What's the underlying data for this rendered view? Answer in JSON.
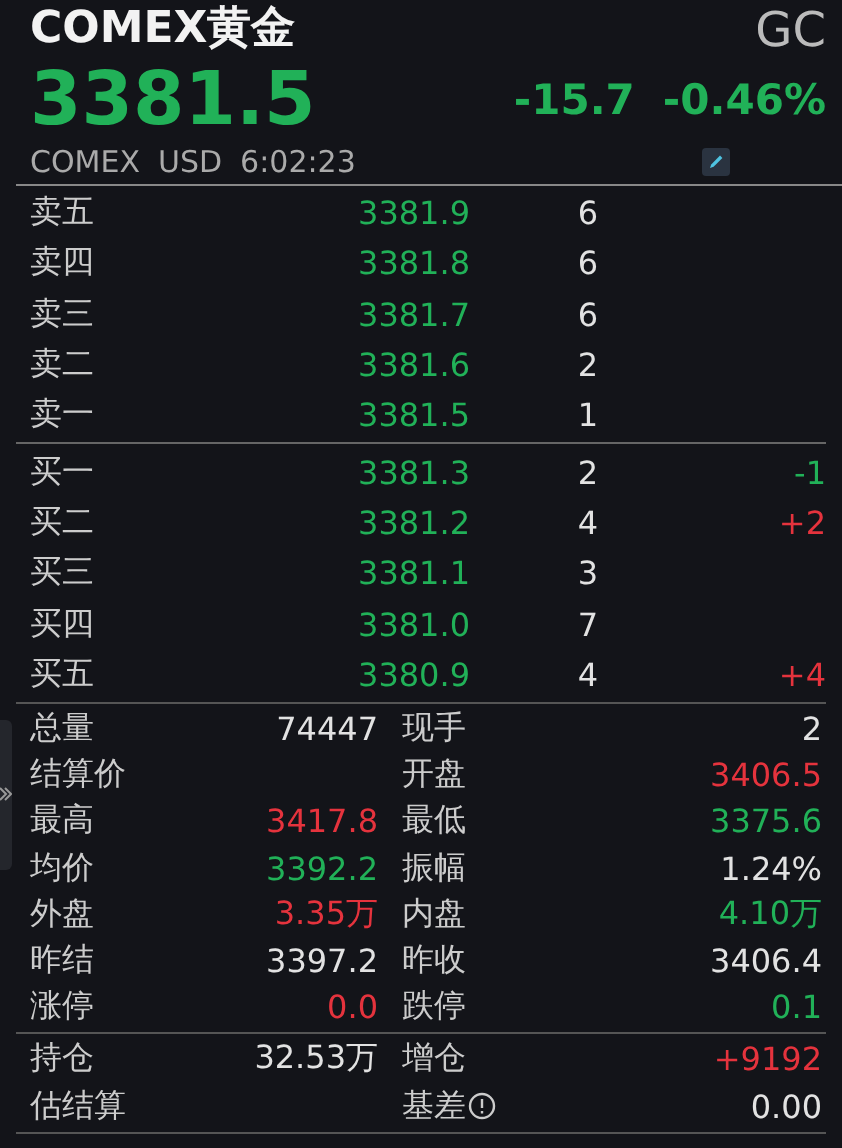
{
  "header": {
    "name": "COMEX黄金",
    "code": "GC",
    "price": "3381.5",
    "change": "-15.7",
    "change_pct": "-0.46%",
    "color": "#21b158",
    "exchange": "COMEX",
    "currency": "USD",
    "time": "6:02:23"
  },
  "asks": [
    {
      "label": "卖五",
      "price": "3381.9",
      "volume": "6"
    },
    {
      "label": "卖四",
      "price": "3381.8",
      "volume": "6"
    },
    {
      "label": "卖三",
      "price": "3381.7",
      "volume": "6"
    },
    {
      "label": "卖二",
      "price": "3381.6",
      "volume": "2"
    },
    {
      "label": "卖一",
      "price": "3381.5",
      "volume": "1"
    }
  ],
  "bids": [
    {
      "label": "买一",
      "price": "3381.3",
      "volume": "2",
      "delta": "-1",
      "color": "#21b158"
    },
    {
      "label": "买二",
      "price": "3381.2",
      "volume": "4",
      "delta": "+2",
      "color": "#e5333d"
    },
    {
      "label": "买三",
      "price": "3381.1",
      "volume": "3"
    },
    {
      "label": "买四",
      "price": "3381.0",
      "volume": "7"
    },
    {
      "label": "买五",
      "price": "3380.9",
      "volume": "4",
      "delta": "+4",
      "color": "#e5333d"
    }
  ],
  "stats": [
    {
      "label": "总量",
      "value": "74447",
      "color": "#e2e2e2"
    },
    {
      "label": "现手",
      "value": "2",
      "color": "#e2e2e2"
    },
    {
      "label": "结算价"
    },
    {
      "label": "开盘",
      "value": "3406.5",
      "color": "#e5333d"
    },
    {
      "label": "最高",
      "value": "3417.8",
      "color": "#e5333d"
    },
    {
      "label": "最低",
      "value": "3375.6",
      "color": "#21b158"
    },
    {
      "label": "均价",
      "value": "3392.2",
      "color": "#21b158"
    },
    {
      "label": "振幅",
      "value": "1.24%",
      "color": "#e2e2e2"
    },
    {
      "label": "外盘",
      "value": "3.35万",
      "color": "#e5333d"
    },
    {
      "label": "内盘",
      "value": "4.10万",
      "color": "#21b158"
    },
    {
      "label": "昨结",
      "value": "3397.2",
      "color": "#e2e2e2"
    },
    {
      "label": "昨收",
      "value": "3406.4",
      "color": "#e2e2e2"
    },
    {
      "label": "涨停",
      "value": "0.0",
      "color": "#e5333d"
    },
    {
      "label": "跌停",
      "value": "0.1",
      "color": "#21b158"
    }
  ],
  "position": [
    {
      "label": "持仓",
      "value": "32.53万",
      "color": "#e2e2e2"
    },
    {
      "label": "增仓",
      "value": "+9192",
      "color": "#e5333d"
    },
    {
      "label": "估结算"
    },
    {
      "label": "基差",
      "value": "0.00",
      "color": "#e2e2e2",
      "info": true
    }
  ]
}
